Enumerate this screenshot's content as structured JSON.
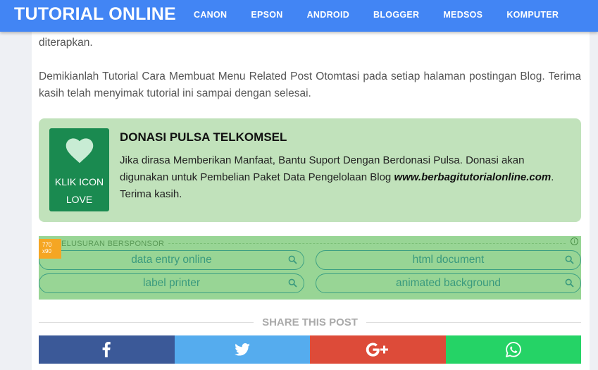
{
  "header": {
    "brand": "TUTORIAL ONLINE",
    "nav": [
      "CANON",
      "EPSON",
      "ANDROID",
      "BLOGGER",
      "MEDSOS",
      "KOMPUTER"
    ]
  },
  "article": {
    "para1": "diterapkan.",
    "para2": "Demikianlah Tutorial Cara Membuat Menu Related Post Otomtasi pada setiap halaman postingan Blog. Terima kasih telah menyimak tutorial ini sampai dengan selesai."
  },
  "donation": {
    "icon_label_line1": "KLIK ICON",
    "icon_label_line2": "LOVE",
    "title": "DONASI PULSA TELKOMSEL",
    "text_before": "Jika dirasa Memberikan Manfaat, Bantu Suport Dengan Berdonasi Pulsa. Donasi akan digunakan untuk Pembelian Paket Data Pengelolaan Blog ",
    "site": "www.berbagitutorialonline.com",
    "text_after": ". Terima kasih.",
    "box_color": "#c1e2bb",
    "icon_color": "#1a8a50"
  },
  "sponsored": {
    "badge_line1": "770",
    "badge_line2": "x90",
    "label": "ELUSURAN BERSPONSOR",
    "info": "i",
    "searches": [
      "data entry online",
      "html document",
      "label printer",
      "animated background"
    ]
  },
  "share": {
    "title": "SHARE THIS POST",
    "buttons": [
      {
        "icon": "facebook-icon",
        "color": "#3b5998"
      },
      {
        "icon": "twitter-icon",
        "color": "#55acee"
      },
      {
        "icon": "google-plus-icon",
        "color": "#dd4b39"
      },
      {
        "icon": "whatsapp-icon",
        "color": "#25d366"
      }
    ]
  }
}
